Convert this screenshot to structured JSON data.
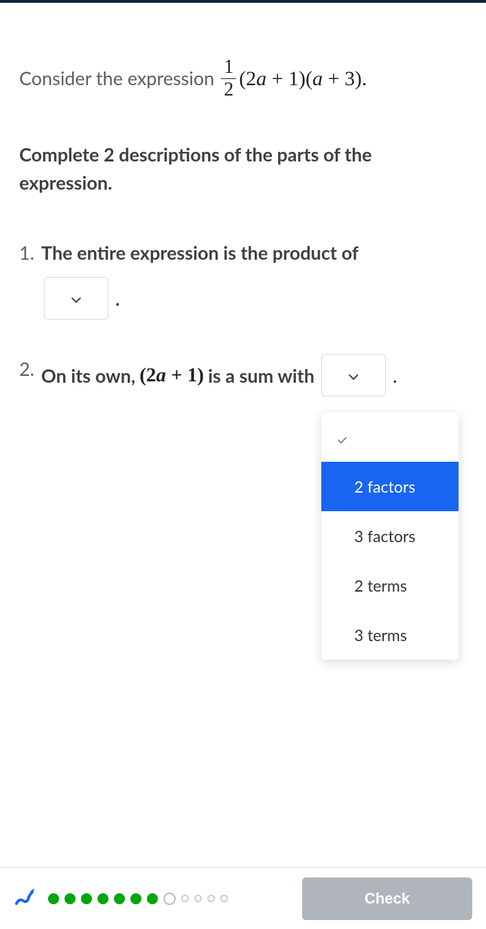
{
  "intro": {
    "prefix": "Consider the expression",
    "frac_num": "1",
    "frac_den": "2",
    "expr_part1": "(2",
    "expr_var1": "a",
    "expr_part2": " + 1)(",
    "expr_var2": "a",
    "expr_part3": " + 3).",
    "period": "."
  },
  "prompt": "Complete 2 descriptions of the parts of the expression.",
  "questions": {
    "q1": {
      "number": "1.",
      "text": "The entire expression is the product of",
      "period": "."
    },
    "q2": {
      "number": "2.",
      "prefix": "On its own,",
      "math_open": "(2",
      "math_var": "a",
      "math_close": " + 1)",
      "suffix": "is a sum with",
      "period": "."
    }
  },
  "dropdown_options": [
    "2 factors",
    "3 factors",
    "2 terms",
    "3 terms"
  ],
  "footer": {
    "check_label": "Check",
    "progress": {
      "filled": 7,
      "current": 1,
      "empty": 4
    }
  }
}
